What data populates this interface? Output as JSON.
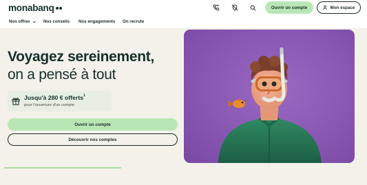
{
  "brand": {
    "name": "monabanq"
  },
  "header": {
    "icons": [
      "phone-icon",
      "location-off-icon",
      "search-icon"
    ],
    "open_account_label": "Ouvrir un compte",
    "my_space_label": "Mon espace"
  },
  "nav": {
    "items": [
      {
        "label": "Nos offres",
        "has_dropdown": true
      },
      {
        "label": "Nos conseils"
      },
      {
        "label": "Nos engagements"
      },
      {
        "label": "On recrute"
      }
    ]
  },
  "hero": {
    "title_line1": "Voyagez sereinement,",
    "title_line2": "on a pensé à tout",
    "offer_title": "Jusqu'à 280 € offerts",
    "offer_footnote": "1",
    "offer_subtitle": "pour l'ouverture d'un compte",
    "open_account_label": "Ouvrir un compte",
    "discover_label": "Découvrir nos comptes",
    "carousel_progress": 1.0
  },
  "colors": {
    "accent_green": "#b9e6b5",
    "dark": "#1b2b2a",
    "background": "#f3f1ea",
    "image_purple": "#8a5bb3"
  }
}
